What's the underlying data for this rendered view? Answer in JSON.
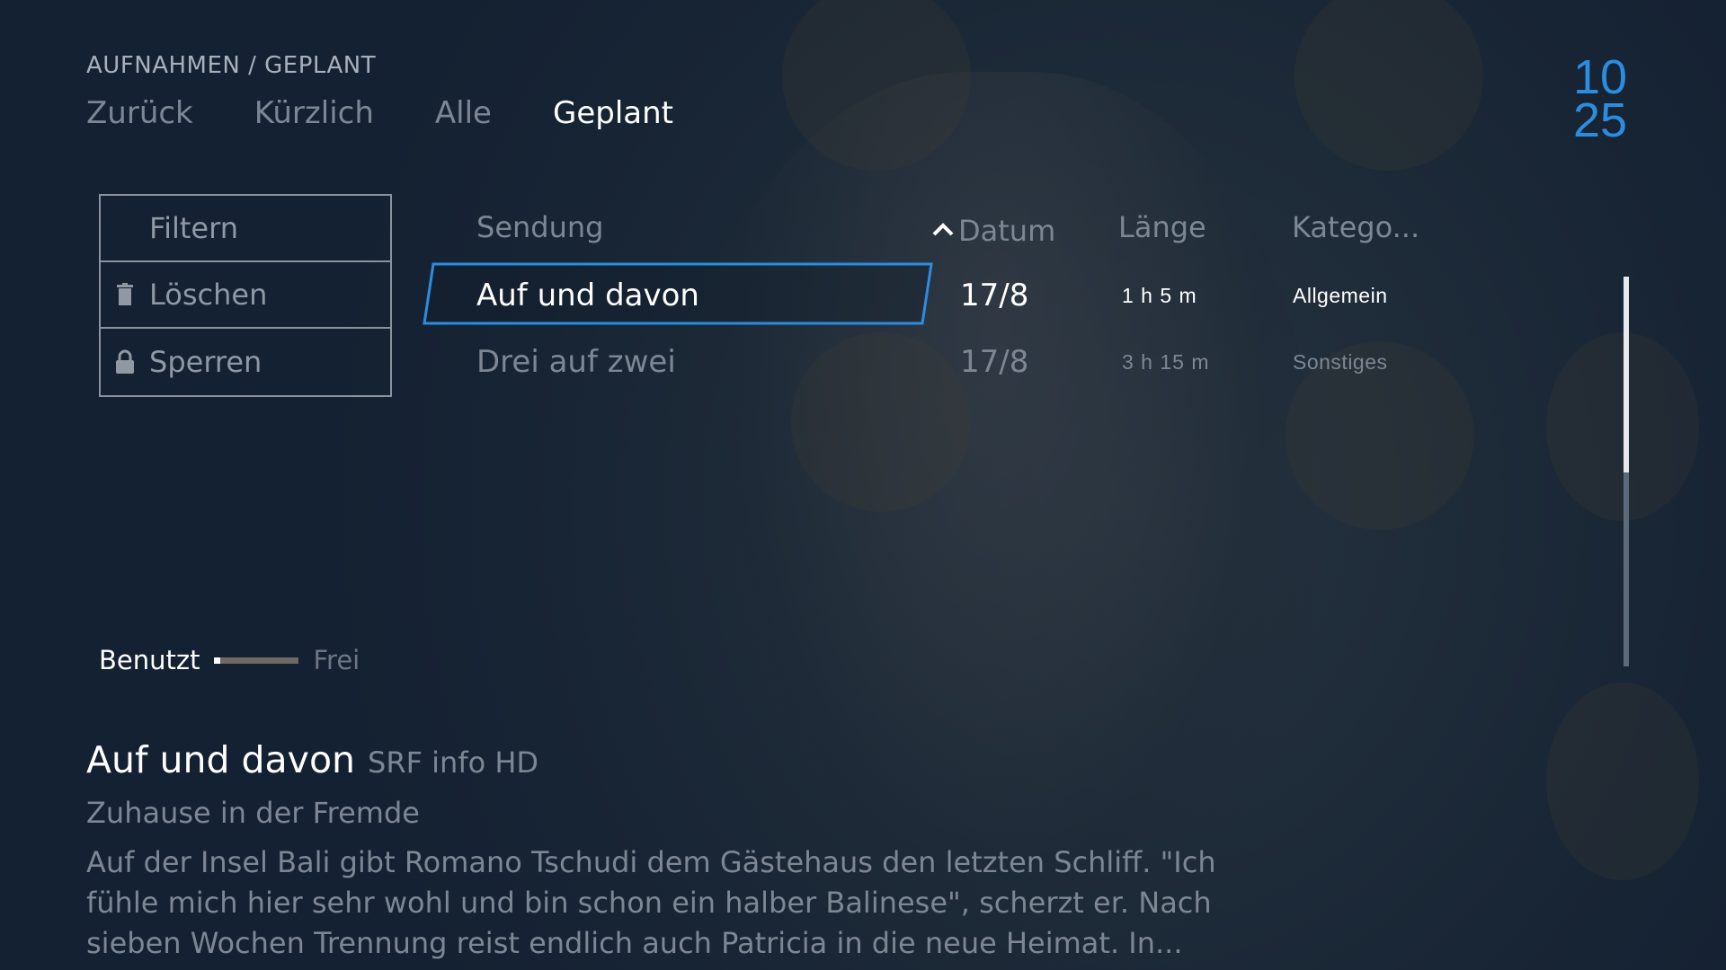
{
  "breadcrumb": "AUFNAHMEN / GEPLANT",
  "nav": {
    "tabs": [
      {
        "label": "Zurück",
        "active": false
      },
      {
        "label": "Kürzlich",
        "active": false
      },
      {
        "label": "Alle",
        "active": false
      },
      {
        "label": "Geplant",
        "active": true
      }
    ]
  },
  "clock": {
    "hours": "10",
    "minutes": "25"
  },
  "actions": [
    {
      "label": "Filtern",
      "icon": ""
    },
    {
      "label": "Löschen",
      "icon": "trash-icon"
    },
    {
      "label": "Sperren",
      "icon": "lock-icon"
    }
  ],
  "table": {
    "columns": {
      "title": "Sendung",
      "date": "Datum",
      "length": "Länge",
      "category": "Katego..."
    },
    "sort": {
      "column": "date",
      "direction": "ascending"
    },
    "rows": [
      {
        "title": "Auf und davon",
        "date": "17/8",
        "length": "1 h 5 m",
        "category": "Allgemein",
        "selected": true
      },
      {
        "title": "Drei auf zwei",
        "date": "17/8",
        "length": "3 h 15 m",
        "category": "Sonstiges",
        "selected": false
      }
    ]
  },
  "storage": {
    "used_label": "Benutzt",
    "free_label": "Frei",
    "used_fraction": 0.07
  },
  "detail": {
    "title": "Auf und davon",
    "channel": "SRF info HD",
    "subtitle": "Zuhause in der Fremde",
    "description": "Auf der Insel Bali gibt Romano Tschudi dem Gästehaus den letzten Schliff. \"Ich fühle mich hier sehr wohl und bin schon ein halber Balinese\", scherzt er. Nach sieben Wochen Trennung reist endlich auch Patricia in die neue Heimat. In..."
  },
  "colors": {
    "accent": "#2b8de0",
    "text_primary": "#ffffff",
    "text_dim": "#7d8794",
    "background": "#1a2636"
  }
}
